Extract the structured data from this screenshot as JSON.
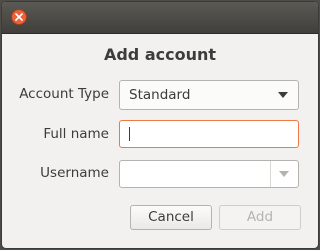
{
  "dialog": {
    "title": "Add account",
    "close_icon": "close-icon"
  },
  "form": {
    "account_type": {
      "label": "Account Type",
      "value": "Standard"
    },
    "full_name": {
      "label": "Full name",
      "value": ""
    },
    "username": {
      "label": "Username",
      "value": ""
    }
  },
  "buttons": {
    "cancel": "Cancel",
    "add": "Add"
  },
  "colors": {
    "focus_border": "#f07746",
    "close_button": "#e9623b",
    "titlebar": "#403f3b"
  }
}
